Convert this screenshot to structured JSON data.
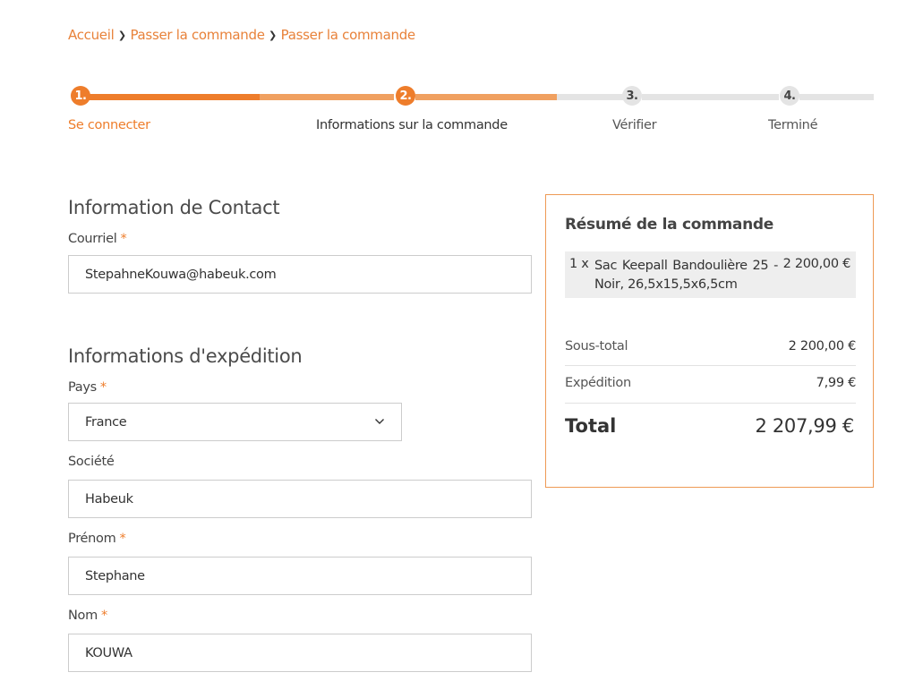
{
  "breadcrumb": {
    "items": [
      "Accueil",
      "Passer la commande",
      "Passer la commande"
    ]
  },
  "stepper": {
    "steps": [
      {
        "number": "1.",
        "label": "Se connecter",
        "state": "done"
      },
      {
        "number": "2.",
        "label": "Informations sur la commande",
        "state": "current"
      },
      {
        "number": "3.",
        "label": "Vérifier",
        "state": "pending"
      },
      {
        "number": "4.",
        "label": "Terminé",
        "state": "pending"
      }
    ],
    "colors": {
      "active": "#ee7d2b",
      "active_light": "#f0a060",
      "pending": "#e4e4e4"
    }
  },
  "contact": {
    "heading": "Information de Contact",
    "email_label": "Courriel",
    "email_value": "StepahneKouwa@habeuk.com",
    "required_mark": "*"
  },
  "shipping": {
    "heading": "Informations d'expédition",
    "country_label": "Pays",
    "country_value": "France",
    "company_label": "Société",
    "company_value": "Habeuk",
    "firstname_label": "Prénom",
    "firstname_value": "Stephane",
    "lastname_label": "Nom",
    "lastname_value": "KOUWA",
    "required_mark": "*"
  },
  "summary": {
    "title": "Résumé de la commande",
    "item": {
      "qty": "1 x",
      "name": "Sac Keepall Bandoulière 25 - Noir, 26,5x15,5x6,5cm",
      "price": "2 200,00 €"
    },
    "subtotal_label": "Sous-total",
    "subtotal_value": "2 200,00 €",
    "shipping_label": "Expédition",
    "shipping_value": "7,99 €",
    "total_label": "Total",
    "total_value": "2 207,99 €"
  },
  "accent_color": "#ee7d2b"
}
